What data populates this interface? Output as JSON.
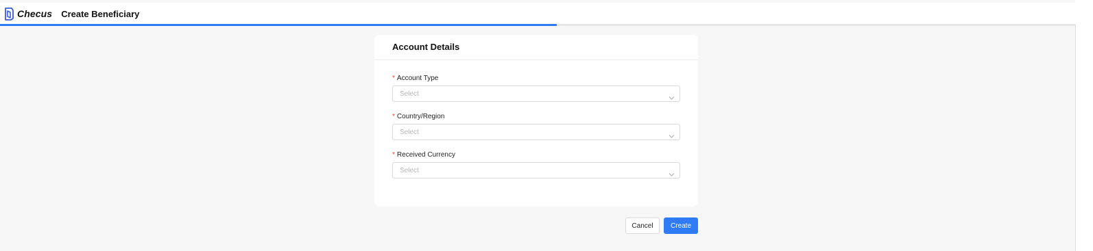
{
  "app": {
    "brand": "Checus",
    "title": "Create Beneficiary"
  },
  "progress": {
    "percent": 51.8,
    "color": "#2f7bf5"
  },
  "card": {
    "title": "Account Details",
    "fields": [
      {
        "required_mark": "*",
        "label": "Account Type",
        "placeholder": "Select"
      },
      {
        "required_mark": "*",
        "label": "Country/Region",
        "placeholder": "Select"
      },
      {
        "required_mark": "*",
        "label": "Received Currency",
        "placeholder": "Select"
      }
    ]
  },
  "actions": {
    "cancel_label": "Cancel",
    "create_label": "Create"
  },
  "icons": {
    "logo": "checus-logo-icon",
    "close": "close-icon",
    "dropdown": "chevron-down-icon"
  },
  "colors": {
    "accent": "#2f7bf5",
    "required": "#e5484d",
    "background": "#f7f7f7"
  }
}
